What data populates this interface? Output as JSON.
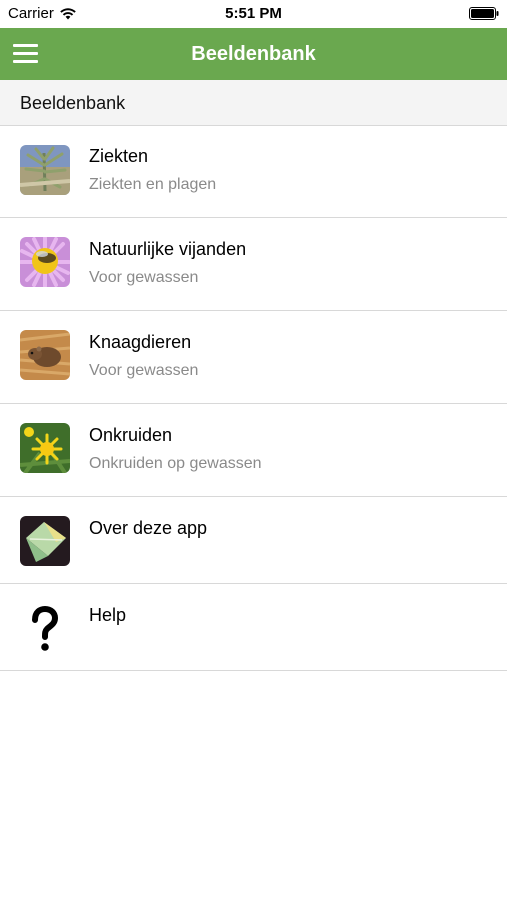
{
  "status_bar": {
    "carrier": "Carrier",
    "time": "5:51 PM",
    "wifi_icon": "wifi-icon",
    "battery_icon": "battery-icon"
  },
  "nav_bar": {
    "title": "Beeldenbank",
    "menu_icon": "hamburger-menu-icon",
    "color": "#6aa84f"
  },
  "section_header": "Beeldenbank",
  "items": [
    {
      "title": "Ziekten",
      "subtitle": "Ziekten en plagen",
      "icon": "diseased-plant-thumbnail"
    },
    {
      "title": "Natuurlijke vijanden",
      "subtitle": "Voor gewassen",
      "icon": "insect-on-flower-thumbnail"
    },
    {
      "title": "Knaagdieren",
      "subtitle": "Voor gewassen",
      "icon": "rodent-thumbnail"
    },
    {
      "title": "Onkruiden",
      "subtitle": "Onkruiden op gewassen",
      "icon": "dandelion-thumbnail"
    },
    {
      "title": "Over deze app",
      "subtitle": "",
      "icon": "app-logo-icon"
    },
    {
      "title": "Help",
      "subtitle": "",
      "icon": "question-mark-icon"
    }
  ]
}
